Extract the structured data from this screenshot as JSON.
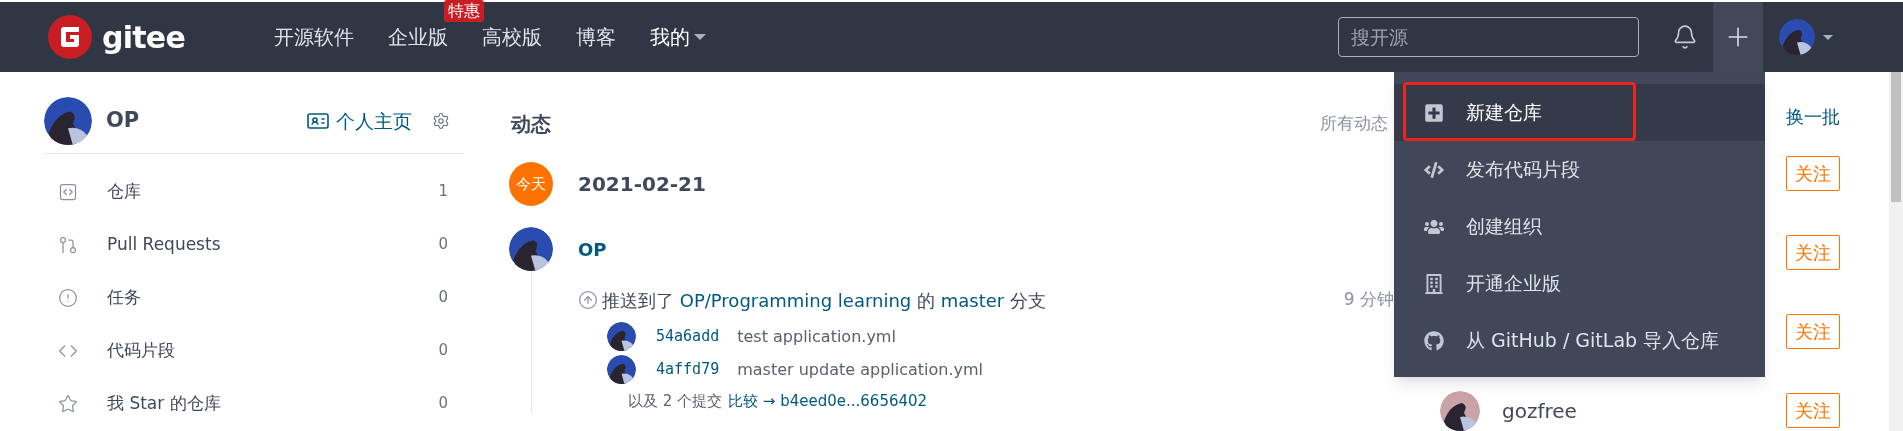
{
  "nav": {
    "logo_text": "gitee",
    "links": [
      {
        "label": "开源软件",
        "strong": false
      },
      {
        "label": "企业版",
        "badge": "特惠",
        "strong": false
      },
      {
        "label": "高校版",
        "strong": false
      },
      {
        "label": "博客",
        "strong": false
      },
      {
        "label": "我的",
        "strong": true
      }
    ],
    "search": {
      "placeholder": "搜开源"
    },
    "create_open": true
  },
  "create_menu": [
    {
      "kind": "new-repo",
      "label": "新建仓库",
      "selected": true
    },
    {
      "kind": "snippet",
      "label": "发布代码片段",
      "selected": false
    },
    {
      "kind": "org",
      "label": "创建组织",
      "selected": false
    },
    {
      "kind": "enterprise",
      "label": "开通企业版",
      "selected": false
    },
    {
      "kind": "import",
      "label": "从 GitHub / GitLab 导入仓库",
      "selected": false
    }
  ],
  "sidebar": {
    "user": "OP",
    "home_link": "个人主页",
    "items": [
      {
        "kind": "repo",
        "label": "仓库",
        "count": "1"
      },
      {
        "kind": "pr",
        "label": "Pull Requests",
        "count": "0"
      },
      {
        "kind": "issue",
        "label": "任务",
        "count": "0"
      },
      {
        "kind": "snippet",
        "label": "代码片段",
        "count": "0"
      },
      {
        "kind": "star",
        "label": "我 Star 的仓库",
        "count": "0"
      }
    ]
  },
  "feed": {
    "title": "动态",
    "filter": "所有动态",
    "date_badge": "今天",
    "date": "2021-02-21",
    "event": {
      "user": "OP",
      "verb": "推送到了",
      "repo": "OP/Programming learning",
      "of": "的",
      "branch": "master",
      "suffix": "分支",
      "time": "9 分钟",
      "commits": [
        {
          "hash": "54a6add",
          "message": "test application.yml"
        },
        {
          "hash": "4affd79",
          "message": "master update application.yml"
        }
      ],
      "more": "以及 2 个提交",
      "compare": "比较 → b4eed0e...6656402"
    }
  },
  "recommend": {
    "refresh": "换一批",
    "users": [
      {
        "follow": "关注"
      },
      {
        "follow": "关注"
      },
      {
        "follow": "关注"
      },
      {
        "name": "gozfree",
        "follow": "关注"
      }
    ]
  }
}
